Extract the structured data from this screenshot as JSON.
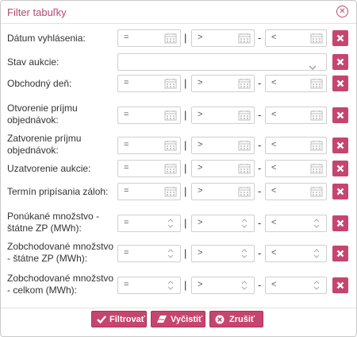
{
  "dialog": {
    "title": "Filter tabuľky"
  },
  "rows": [
    {
      "label": "Dátum vyhlásenia:",
      "kind": "date",
      "from_op": "=",
      "mid_op": ">",
      "to_op": "<"
    },
    {
      "label": "Stav aukcie:",
      "kind": "select",
      "value": ""
    },
    {
      "label": "Obchodný deň:",
      "kind": "date",
      "from_op": "=",
      "mid_op": ">",
      "to_op": "<"
    },
    {
      "label": "Otvorenie príjmu objednávok:",
      "kind": "date",
      "from_op": "=",
      "mid_op": ">",
      "to_op": "<"
    },
    {
      "label": "Zatvorenie príjmu objednávok:",
      "kind": "date",
      "from_op": "=",
      "mid_op": ">",
      "to_op": "<"
    },
    {
      "label": "Uzatvorenie aukcie:",
      "kind": "date",
      "from_op": "=",
      "mid_op": ">",
      "to_op": "<"
    },
    {
      "label": "Termín pripísania záloh:",
      "kind": "date",
      "from_op": "=",
      "mid_op": ">",
      "to_op": "<"
    },
    {
      "label": "Ponúkané množstvo - štátne ZP (MWh):",
      "kind": "number",
      "from_op": "=",
      "mid_op": ">",
      "to_op": "<"
    },
    {
      "label": "Zobchodované množstvo - štátne ZP (MWh):",
      "kind": "number",
      "from_op": "=",
      "mid_op": ">",
      "to_op": "<"
    },
    {
      "label": "Zobchodované množstvo - celkom (MWh):",
      "kind": "number",
      "from_op": "=",
      "mid_op": ">",
      "to_op": "<"
    }
  ],
  "separators": {
    "bar": "|",
    "dash": "-"
  },
  "buttons": {
    "filter": "Filtrovať",
    "clear": "Vyčistiť",
    "cancel": "Zrušiť"
  },
  "icons": {
    "close": "close-circle-icon",
    "remove": "times-icon",
    "date": "calendar-icon",
    "number": "spinner-icon",
    "select": "chevron-down-icon"
  },
  "colors": {
    "accent": "#c6456f",
    "title": "#b54a72"
  }
}
